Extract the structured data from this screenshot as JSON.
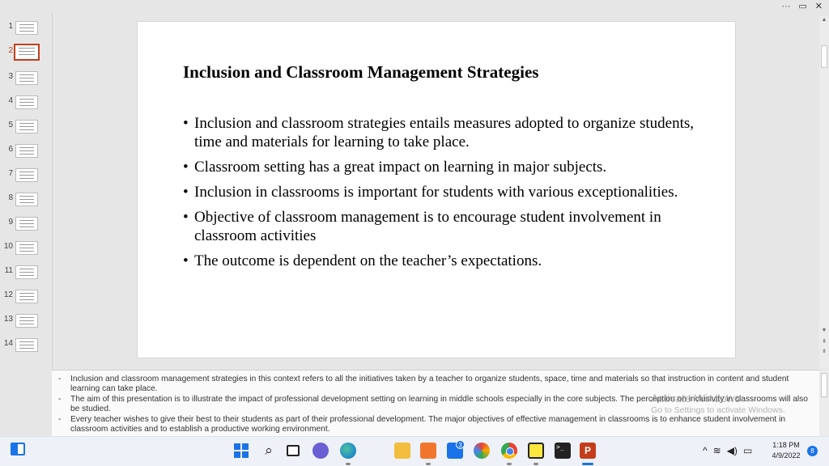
{
  "window_controls": {
    "more": "···",
    "restore": "▭",
    "close": "✕"
  },
  "thumbnails": {
    "active_index": 1,
    "numbers": [
      "1",
      "2",
      "3",
      "4",
      "5",
      "6",
      "7",
      "8",
      "9",
      "10",
      "11",
      "12",
      "13",
      "14"
    ]
  },
  "slide": {
    "title": "Inclusion and Classroom Management Strategies",
    "bullets": [
      "Inclusion and classroom strategies entails  measures adopted to organize students, time and materials for learning to take place.",
      "Classroom setting has a great impact on learning in major subjects.",
      "Inclusion in classrooms is important for students with various exceptionalities.",
      "Objective of classroom management is  to encourage student involvement in classroom activities",
      "The outcome is dependent on the teacher’s expectations."
    ]
  },
  "notes": [
    "Inclusion and classroom management strategies in this context refers to all the initiatives taken by a teacher to organize students, space, time and materials so that instruction in content and student learning can take place.",
    "The aim of this presentation is to illustrate the impact of professional development setting on learning in middle schools especially in the core subjects. The perception on inclusivity in classrooms will also be studied.",
    "Every teacher wishes to give their best to their students as part of their professional development. The major objectives of effective management in classrooms is to enhance student involvement in classroom activities and to establish a productive working environment."
  ],
  "watermark": {
    "line1": "Activate Windows",
    "line2": "Go to Settings to activate Windows."
  },
  "taskbar": {
    "mail_badge": "3",
    "ppt_label": "P",
    "terminal_label": ">_",
    "tray": {
      "chevron": "^",
      "wifi": "≋",
      "volume": "◀)",
      "battery": "▭"
    },
    "time": "1:18 PM",
    "date": "4/9/2022",
    "notifications": "8"
  },
  "colors": {
    "accent": "#c43e1c",
    "taskbar_blue": "#1a73e8"
  }
}
